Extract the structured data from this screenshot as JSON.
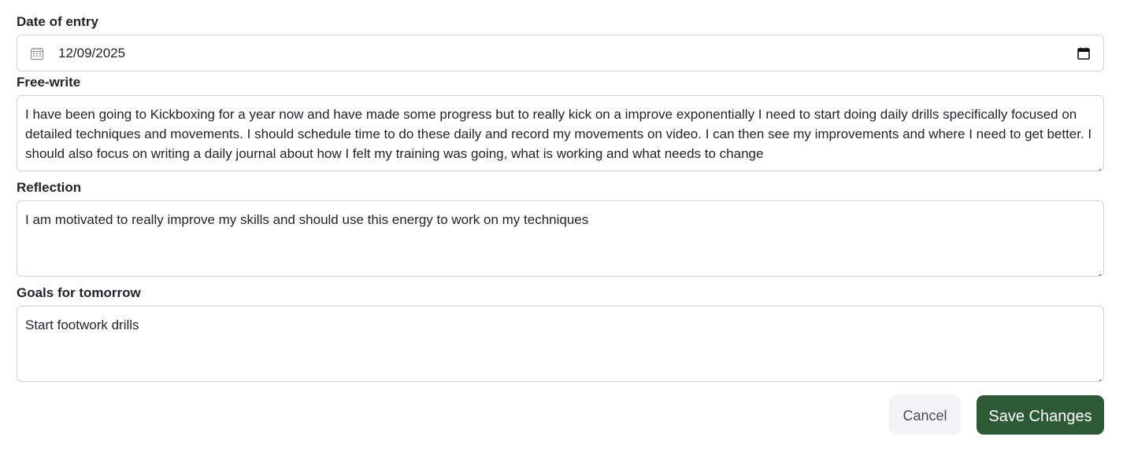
{
  "entry_form": {
    "date_label": "Date of entry",
    "date_value": "12/09/2025",
    "freewrite_label": "Free-write",
    "freewrite_value": "I have been going to Kickboxing for a year now and have made some progress but to really kick on a improve exponentially I need to start doing daily drills specifically focused on detailed techniques and movements. I should schedule time to do these daily and record my movements on video. I can then see my improvements and where I need to get better. I should also focus on writing a daily journal about how I felt my training was going, what is working and what needs to change",
    "reflection_label": "Reflection",
    "reflection_value": "I am motivated to really improve my skills and should use this energy to work on my techniques",
    "goals_label": "Goals for tomorrow",
    "goals_value": "Start footwork drills"
  },
  "actions": {
    "cancel_label": "Cancel",
    "save_label": "Save Changes"
  },
  "icons": {
    "date_field_icon": "calendar-icon",
    "date_picker_icon": "calendar-picker-icon",
    "resize_icon": "resize-handle-icon"
  },
  "colors": {
    "save_button_bg": "#2d5a35",
    "cancel_button_bg": "#f1f3f5",
    "border": "#ced4da",
    "text": "#212529"
  }
}
